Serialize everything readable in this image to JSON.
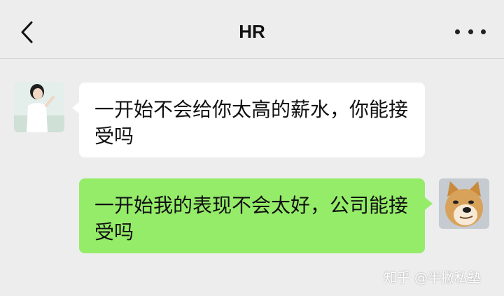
{
  "header": {
    "title": "HR",
    "back_icon": "chevron-left-icon",
    "more_icon": "more-horizontal-icon"
  },
  "messages": [
    {
      "side": "left",
      "text": "一开始不会给你太高的薪水，你能接受吗",
      "bubble_color": "#ffffff"
    },
    {
      "side": "right",
      "text": "一开始我的表现不会太好，公司能接受吗",
      "bubble_color": "#95ec69"
    }
  ],
  "watermark": "知乎 @半撇私塾",
  "colors": {
    "background": "#ededed",
    "outgoing_bubble": "#95ec69",
    "incoming_bubble": "#ffffff"
  }
}
